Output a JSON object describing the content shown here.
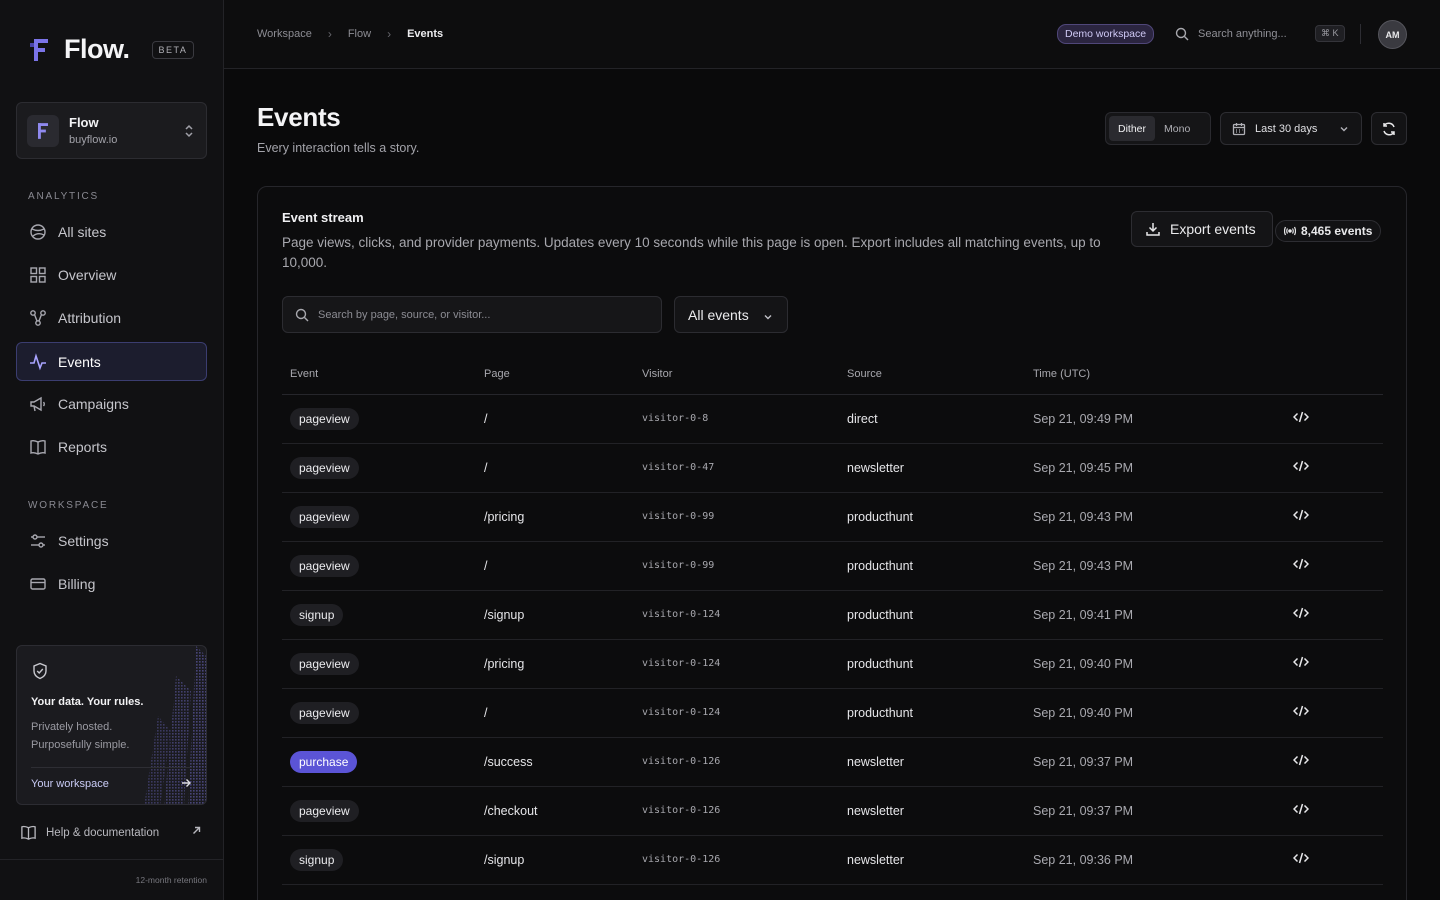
{
  "app": {
    "name": "Flow.",
    "badge": "BETA"
  },
  "site": {
    "name": "Flow",
    "domain": "buyflow.io"
  },
  "sidebar": {
    "analytics_label": "ANALYTICS",
    "analytics_items": [
      {
        "label": "All sites",
        "icon": "globe-icon"
      },
      {
        "label": "Overview",
        "icon": "grid-icon"
      },
      {
        "label": "Attribution",
        "icon": "nodes-icon"
      },
      {
        "label": "Events",
        "icon": "activity-icon",
        "active": true
      },
      {
        "label": "Campaigns",
        "icon": "megaphone-icon"
      },
      {
        "label": "Reports",
        "icon": "book-icon"
      }
    ],
    "workspace_label": "WORKSPACE",
    "workspace_items": [
      {
        "label": "Settings",
        "icon": "sliders-icon"
      },
      {
        "label": "Billing",
        "icon": "credit-card-icon"
      }
    ],
    "promo": {
      "title": "Your data. Your rules.",
      "subtitle": "Privately hosted. Purposefully simple.",
      "link": "Your workspace"
    },
    "help": "Help & documentation",
    "retention": "12-month retention"
  },
  "topbar": {
    "breadcrumbs": [
      "Workspace",
      "Flow",
      "Events"
    ],
    "demo_badge": "Demo workspace",
    "search_placeholder": "Search anything...",
    "shortcut": "⌘ K",
    "avatar_initials": "AM"
  },
  "page": {
    "title": "Events",
    "subtitle": "Every interaction tells a story.",
    "view_toggle": {
      "options": [
        "Dither",
        "Mono"
      ],
      "selected": "Dither"
    },
    "date_range": "Last 30 days"
  },
  "stream": {
    "title": "Event stream",
    "description": "Page views, clicks, and provider payments. Updates every 10 seconds while this page is open. Export includes all matching events, up to 10,000.",
    "export_label": "Export events",
    "count_label": "8,465 events",
    "search_placeholder": "Search by page, source, or visitor...",
    "filter_label": "All events",
    "columns": [
      "Event",
      "Page",
      "Visitor",
      "Source",
      "Time (UTC)"
    ],
    "rows": [
      {
        "event": "pageview",
        "page": "/",
        "visitor": "visitor-0-8",
        "source": "direct",
        "time": "Sep 21, 09:49 PM"
      },
      {
        "event": "pageview",
        "page": "/",
        "visitor": "visitor-0-47",
        "source": "newsletter",
        "time": "Sep 21, 09:45 PM"
      },
      {
        "event": "pageview",
        "page": "/pricing",
        "visitor": "visitor-0-99",
        "source": "producthunt",
        "time": "Sep 21, 09:43 PM"
      },
      {
        "event": "pageview",
        "page": "/",
        "visitor": "visitor-0-99",
        "source": "producthunt",
        "time": "Sep 21, 09:43 PM"
      },
      {
        "event": "signup",
        "page": "/signup",
        "visitor": "visitor-0-124",
        "source": "producthunt",
        "time": "Sep 21, 09:41 PM"
      },
      {
        "event": "pageview",
        "page": "/pricing",
        "visitor": "visitor-0-124",
        "source": "producthunt",
        "time": "Sep 21, 09:40 PM"
      },
      {
        "event": "pageview",
        "page": "/",
        "visitor": "visitor-0-124",
        "source": "producthunt",
        "time": "Sep 21, 09:40 PM"
      },
      {
        "event": "purchase",
        "page": "/success",
        "visitor": "visitor-0-126",
        "source": "newsletter",
        "time": "Sep 21, 09:37 PM",
        "accent": true
      },
      {
        "event": "pageview",
        "page": "/checkout",
        "visitor": "visitor-0-126",
        "source": "newsletter",
        "time": "Sep 21, 09:37 PM"
      },
      {
        "event": "signup",
        "page": "/signup",
        "visitor": "visitor-0-126",
        "source": "newsletter",
        "time": "Sep 21, 09:36 PM"
      }
    ]
  },
  "colors": {
    "accent": "#5b54d6",
    "background": "#0a0a0b",
    "sidebar": "#111113"
  }
}
